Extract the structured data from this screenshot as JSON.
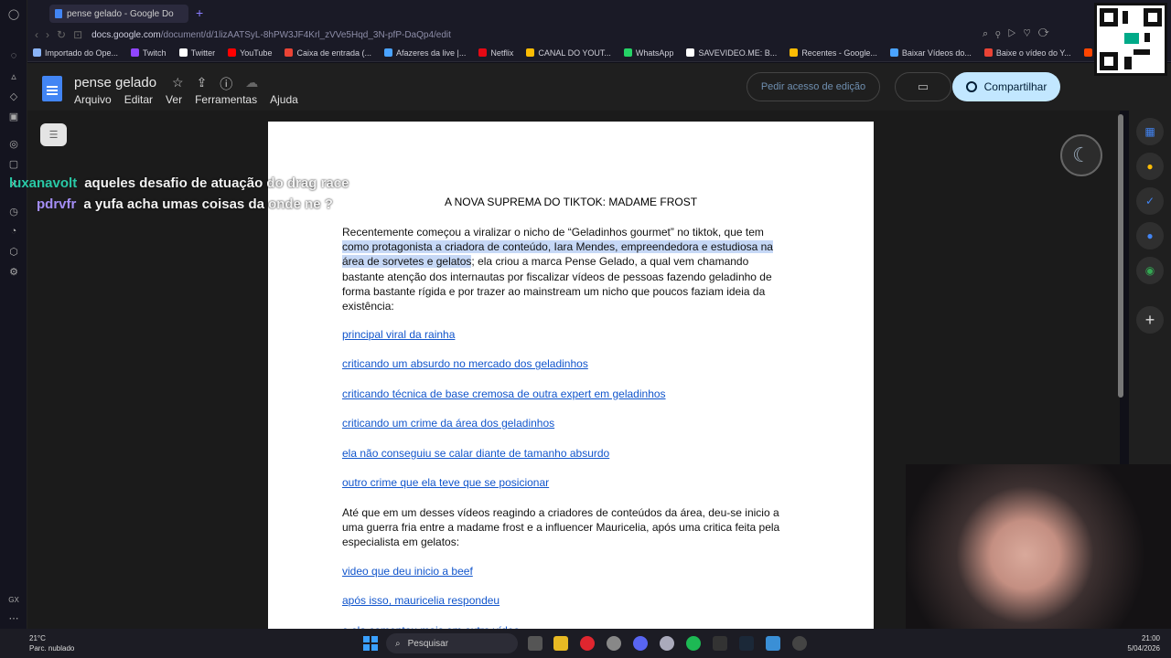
{
  "browser": {
    "tab_title": "pense gelado - Google Do",
    "new_tab_symbol": "+",
    "url_domain": "docs.google.com",
    "url_path": "/document/d/1lizAATSyL-8hPW3JF4Krl_zVVe5Hqd_3N-pfP-DaQp4/edit",
    "bookmarks": [
      {
        "label": "Importado do Ope...",
        "color": "#8ab4f8"
      },
      {
        "label": "Twitch",
        "color": "#9146ff"
      },
      {
        "label": "Twitter",
        "color": "#ffffff"
      },
      {
        "label": "YouTube",
        "color": "#ff0000"
      },
      {
        "label": "Caixa de entrada (...",
        "color": "#ea4335"
      },
      {
        "label": "Afazeres da live |...",
        "color": "#4aa3ff"
      },
      {
        "label": "Netflix",
        "color": "#e50914"
      },
      {
        "label": "CANAL DO YOUT...",
        "color": "#fbbc04"
      },
      {
        "label": "WhatsApp",
        "color": "#25d366"
      },
      {
        "label": "SAVEVIDEO.ME: B...",
        "color": "#ffffff"
      },
      {
        "label": "Recentes - Google...",
        "color": "#fbbc04"
      },
      {
        "label": "Baixar Vídeos do...",
        "color": "#4aa3ff"
      },
      {
        "label": "Baixe o vídeo do Y...",
        "color": "#ea4335"
      },
      {
        "label": "reddit: the fr",
        "color": "#ff4500"
      }
    ]
  },
  "docs": {
    "title": "pense gelado",
    "menus": [
      "Arquivo",
      "Editar",
      "Ver",
      "Ferramentas",
      "Ajuda"
    ],
    "request_edit": "Pedir acesso de edição",
    "share": "Compartilhar"
  },
  "document": {
    "heading": "A NOVA SUPREMA DO TIKTOK: MADAME FROST",
    "p1_a": "Recentemente começou a viralizar o nicho de “Geladinhos gourmet” no tiktok, que tem ",
    "p1_hl": "como protagonista a criadora de conteúdo, Iara Mendes, empreendedora e estudiosa na área de sorvetes e gelatos",
    "p1_b": "; ela criou a marca Pense Gelado, a qual vem chamando bastante atenção dos internautas por fiscalizar vídeos de pessoas fazendo geladinho de forma bastante rígida e por trazer ao mainstream um nicho que poucos faziam ideia da existência:",
    "links1": [
      "principal viral da rainha",
      " criticando um absurdo no mercado dos geladinhos",
      "criticando técnica de base cremosa de outra expert em geladinhos",
      "criticando um crime da área dos geladinhos",
      "ela não conseguiu se calar diante de tamanho absurdo",
      "outro crime que ela teve que se posicionar"
    ],
    "p2": "Até que em um desses vídeos reagindo a criadores de conteúdos da área, deu-se inicio a uma guerra fria entre a madame frost e a influencer Mauricelia, após uma critica feita pela especialista em gelatos:",
    "links2": [
      "video que deu inicio a beef",
      "após isso, mauricelia respondeu",
      "e ela comentou mais em outro vídeo"
    ]
  },
  "chat": [
    {
      "user": "luxanavolt",
      "message": "aqueles desafio de atuação do drag race"
    },
    {
      "user": "pdrvfr",
      "message": "a yufa acha umas coisas da onde ne ?"
    }
  ],
  "taskbar": {
    "temperature": "21°C",
    "weather": "Parc. nublado",
    "search": "Pesquisar",
    "time": "21:00",
    "date": "5/04/2026"
  },
  "colors": {
    "accent": "#8a7cff",
    "share_bg": "#c2e7ff",
    "link": "#1155cc",
    "highlight": "#c6d8f6"
  },
  "icons": {
    "star": "☆",
    "info": "ⓘ",
    "cloud": "☁",
    "camera": "▭",
    "moon": "☾",
    "plus": "+"
  }
}
